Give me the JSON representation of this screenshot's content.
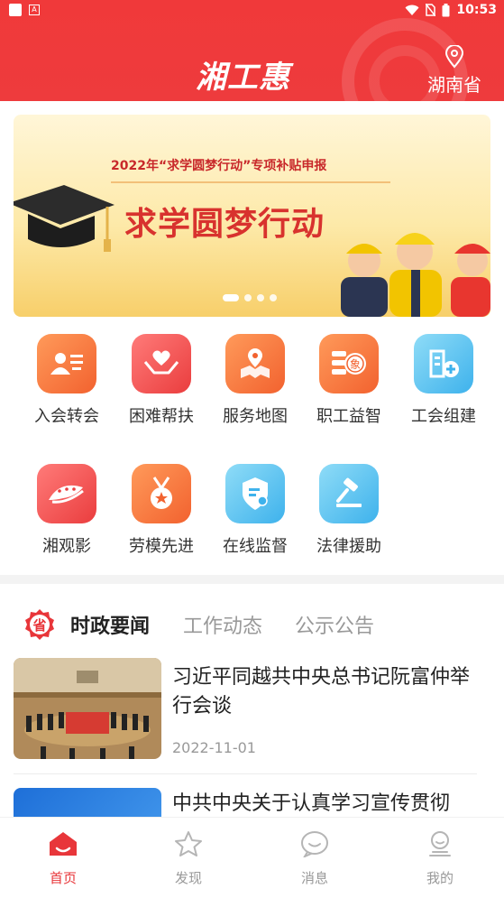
{
  "status_bar": {
    "time": "10:53"
  },
  "header": {
    "title": "湘工惠",
    "location": "湖南省"
  },
  "banner": {
    "subtitle": "2022年“求学圆梦行动”专项补贴申报",
    "title": "求学圆梦行动"
  },
  "services": [
    {
      "label": "入会转会",
      "icon": "membership-card-icon"
    },
    {
      "label": "困难帮扶",
      "icon": "heart-hands-icon"
    },
    {
      "label": "服务地图",
      "icon": "map-pin-icon"
    },
    {
      "label": "职工益智",
      "icon": "chess-icon"
    },
    {
      "label": "工会组建",
      "icon": "building-add-icon"
    },
    {
      "label": "湘观影",
      "icon": "film-icon"
    },
    {
      "label": "劳模先进",
      "icon": "medal-icon"
    },
    {
      "label": "在线监督",
      "icon": "shield-icon"
    },
    {
      "label": "法律援助",
      "icon": "gavel-icon"
    }
  ],
  "news": {
    "badge": "省",
    "tabs": [
      "时政要闻",
      "工作动态",
      "公示公告"
    ],
    "active_tab": "时政要闻",
    "items": [
      {
        "title": "习近平同越共中央总书记阮富仲举行会谈",
        "date": "2022-11-01"
      },
      {
        "title": "中共中央关于认真学习宣传贯彻",
        "date": ""
      }
    ]
  },
  "bottom_nav": [
    {
      "label": "首页",
      "active": true
    },
    {
      "label": "发现",
      "active": false
    },
    {
      "label": "消息",
      "active": false
    },
    {
      "label": "我的",
      "active": false
    }
  ],
  "colors": {
    "brand": "#ee3b3d",
    "accent_text": "#e8363a"
  }
}
